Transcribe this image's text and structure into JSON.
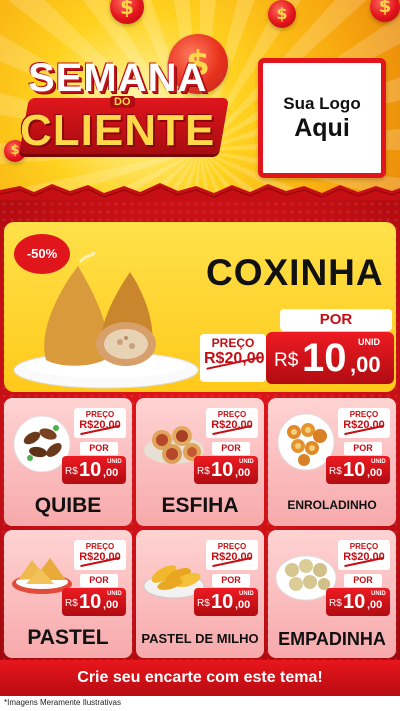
{
  "header": {
    "title_line1": "SEMANA",
    "title_do": "DO",
    "title_line2": "CLIENTE",
    "logo_line1": "Sua Logo",
    "logo_line2": "Aqui",
    "coin_symbol": "$"
  },
  "hero": {
    "discount": "-50%",
    "name": "COXINHA",
    "preco_label": "PREÇO",
    "old_price": "R$20,00",
    "por_label": "POR",
    "unid_label": "UNID",
    "currency": "R$",
    "price_int": "10",
    "price_cents": ",00"
  },
  "products": [
    {
      "name": "QUIBE",
      "preco_label": "PREÇO",
      "old_price": "R$20,00",
      "por_label": "POR",
      "unid_label": "UNID",
      "currency": "R$",
      "price_int": "10",
      "price_cents": ",00",
      "icon": "quibe-icon"
    },
    {
      "name": "ESFIHA",
      "preco_label": "PREÇO",
      "old_price": "R$20,00",
      "por_label": "POR",
      "unid_label": "UNID",
      "currency": "R$",
      "price_int": "10",
      "price_cents": ",00",
      "icon": "esfiha-icon"
    },
    {
      "name": "ENROLADINHO",
      "preco_label": "PREÇO",
      "old_price": "R$20,00",
      "por_label": "POR",
      "unid_label": "UNID",
      "currency": "R$",
      "price_int": "10",
      "price_cents": ",00",
      "icon": "enroladinho-icon"
    },
    {
      "name": "PASTEL",
      "preco_label": "PREÇO",
      "old_price": "R$20,00",
      "por_label": "POR",
      "unid_label": "UNID",
      "currency": "R$",
      "price_int": "10",
      "price_cents": ",00",
      "icon": "pastel-icon"
    },
    {
      "name": "PASTEL DE MILHO",
      "preco_label": "PREÇO",
      "old_price": "R$20,00",
      "por_label": "POR",
      "unid_label": "UNID",
      "currency": "R$",
      "price_int": "10",
      "price_cents": ",00",
      "icon": "pastel-de-milho-icon"
    },
    {
      "name": "EMPADINHA",
      "preco_label": "PREÇO",
      "old_price": "R$20,00",
      "por_label": "POR",
      "unid_label": "UNID",
      "currency": "R$",
      "price_int": "10",
      "price_cents": ",00",
      "icon": "empadinha-icon"
    }
  ],
  "footer": {
    "cta": "Crie seu encarte com este tema!",
    "note": "*Imagens Meramente Ilustrativas"
  },
  "colors": {
    "brand_red": "#e0161c",
    "brand_yellow": "#ffd21f"
  }
}
